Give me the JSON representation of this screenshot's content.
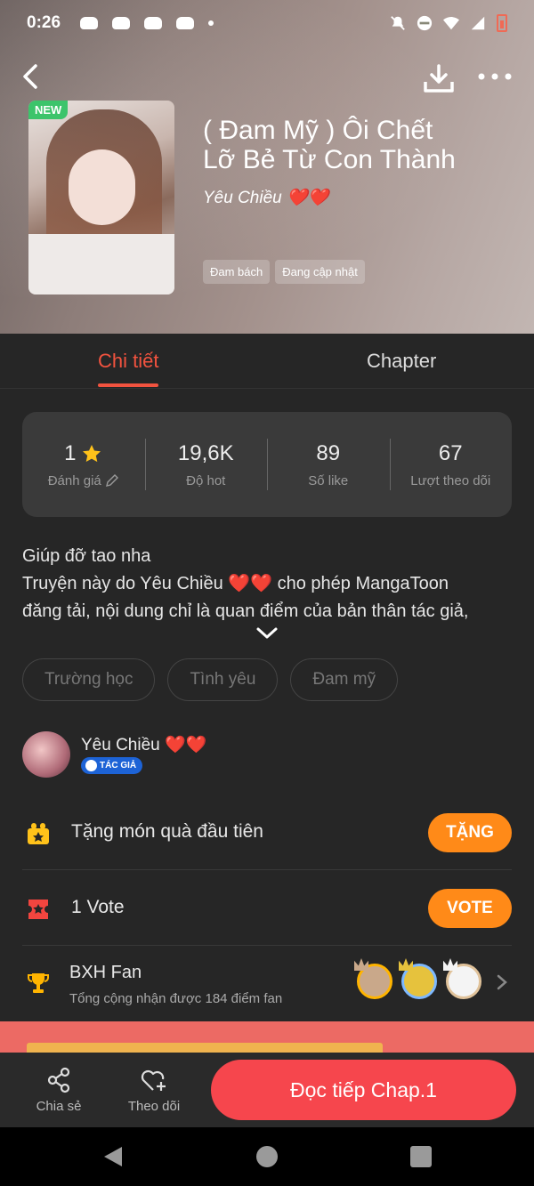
{
  "status_bar": {
    "time": "0:26"
  },
  "header": {
    "badge": "NEW",
    "title_line1": "( Đam Mỹ ) Ôi Chết",
    "title_line2": "Lỡ Bẻ Từ Con Thành",
    "author": "Yêu Chiều ❤️❤️",
    "tags": [
      "Đam bách",
      "Đang cập nhật"
    ]
  },
  "tabs": [
    {
      "label": "Chi tiết"
    },
    {
      "label": "Chapter"
    }
  ],
  "stats": [
    {
      "value": "1",
      "label": "Đánh giá"
    },
    {
      "value": "19,6K",
      "label": "Độ hot"
    },
    {
      "value": "89",
      "label": "Số like"
    },
    {
      "value": "67",
      "label": "Lượt theo dõi"
    }
  ],
  "description": {
    "line1": "Giúp đỡ tao nha",
    "line2": "Truyện này do Yêu Chiều ❤️❤️ cho phép MangaToon",
    "line3": "đăng tải, nội dung chỉ là quan điểm của bản thân tác giả,"
  },
  "genres": [
    "Trường học",
    "Tình yêu",
    "Đam mỹ"
  ],
  "author_section": {
    "name": "Yêu Chiều ❤️❤️",
    "badge": "TÁC GIẢ"
  },
  "gift": {
    "label": "Tặng món quà đầu tiên",
    "button": "TẶNG"
  },
  "vote": {
    "label": "1  Vote",
    "button": "VOTE"
  },
  "fan": {
    "title": "BXH Fan",
    "subtitle": "Tổng cộng nhận được 184 điểm fan"
  },
  "bottom": {
    "share": "Chia sẻ",
    "follow": "Theo dõi",
    "read": "Đọc tiếp Chap.1"
  },
  "colors": {
    "accent": "#f2533f",
    "orange": "#ff8a18",
    "read_button": "#f6464d"
  }
}
